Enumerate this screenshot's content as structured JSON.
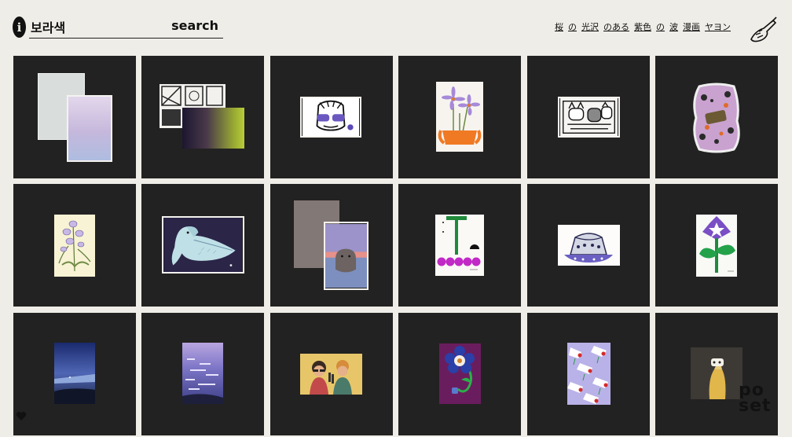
{
  "search": {
    "value": "보라색",
    "button_label": "search"
  },
  "tags": [
    "桜",
    "の",
    "光沢",
    "のある",
    "紫色",
    "の",
    "波",
    "漫画",
    "ヤヨン"
  ],
  "brand": {
    "line1": "po",
    "line2": "set"
  },
  "icons": {
    "info": "info-icon",
    "hand": "hand-drawing-icon",
    "heart": "heart-icon"
  },
  "colors": {
    "background": "#efede7",
    "tile": "#232222",
    "text": "#111111"
  },
  "tiles": [
    {
      "name": "tile-pastel-envelope"
    },
    {
      "name": "tile-comic-gradient"
    },
    {
      "name": "tile-sunglasses-character"
    },
    {
      "name": "tile-purple-flowers"
    },
    {
      "name": "tile-cats-comic"
    },
    {
      "name": "tile-purple-sticker"
    },
    {
      "name": "tile-orchid"
    },
    {
      "name": "tile-pelican"
    },
    {
      "name": "tile-hippo"
    },
    {
      "name": "tile-pink-balls"
    },
    {
      "name": "tile-ufo"
    },
    {
      "name": "tile-morning-glory"
    },
    {
      "name": "tile-night-sea"
    },
    {
      "name": "tile-sparkle-sea"
    },
    {
      "name": "tile-karaoke-duo"
    },
    {
      "name": "tile-blue-flower"
    },
    {
      "name": "tile-white-lilies"
    },
    {
      "name": "tile-yellow-figure"
    }
  ]
}
